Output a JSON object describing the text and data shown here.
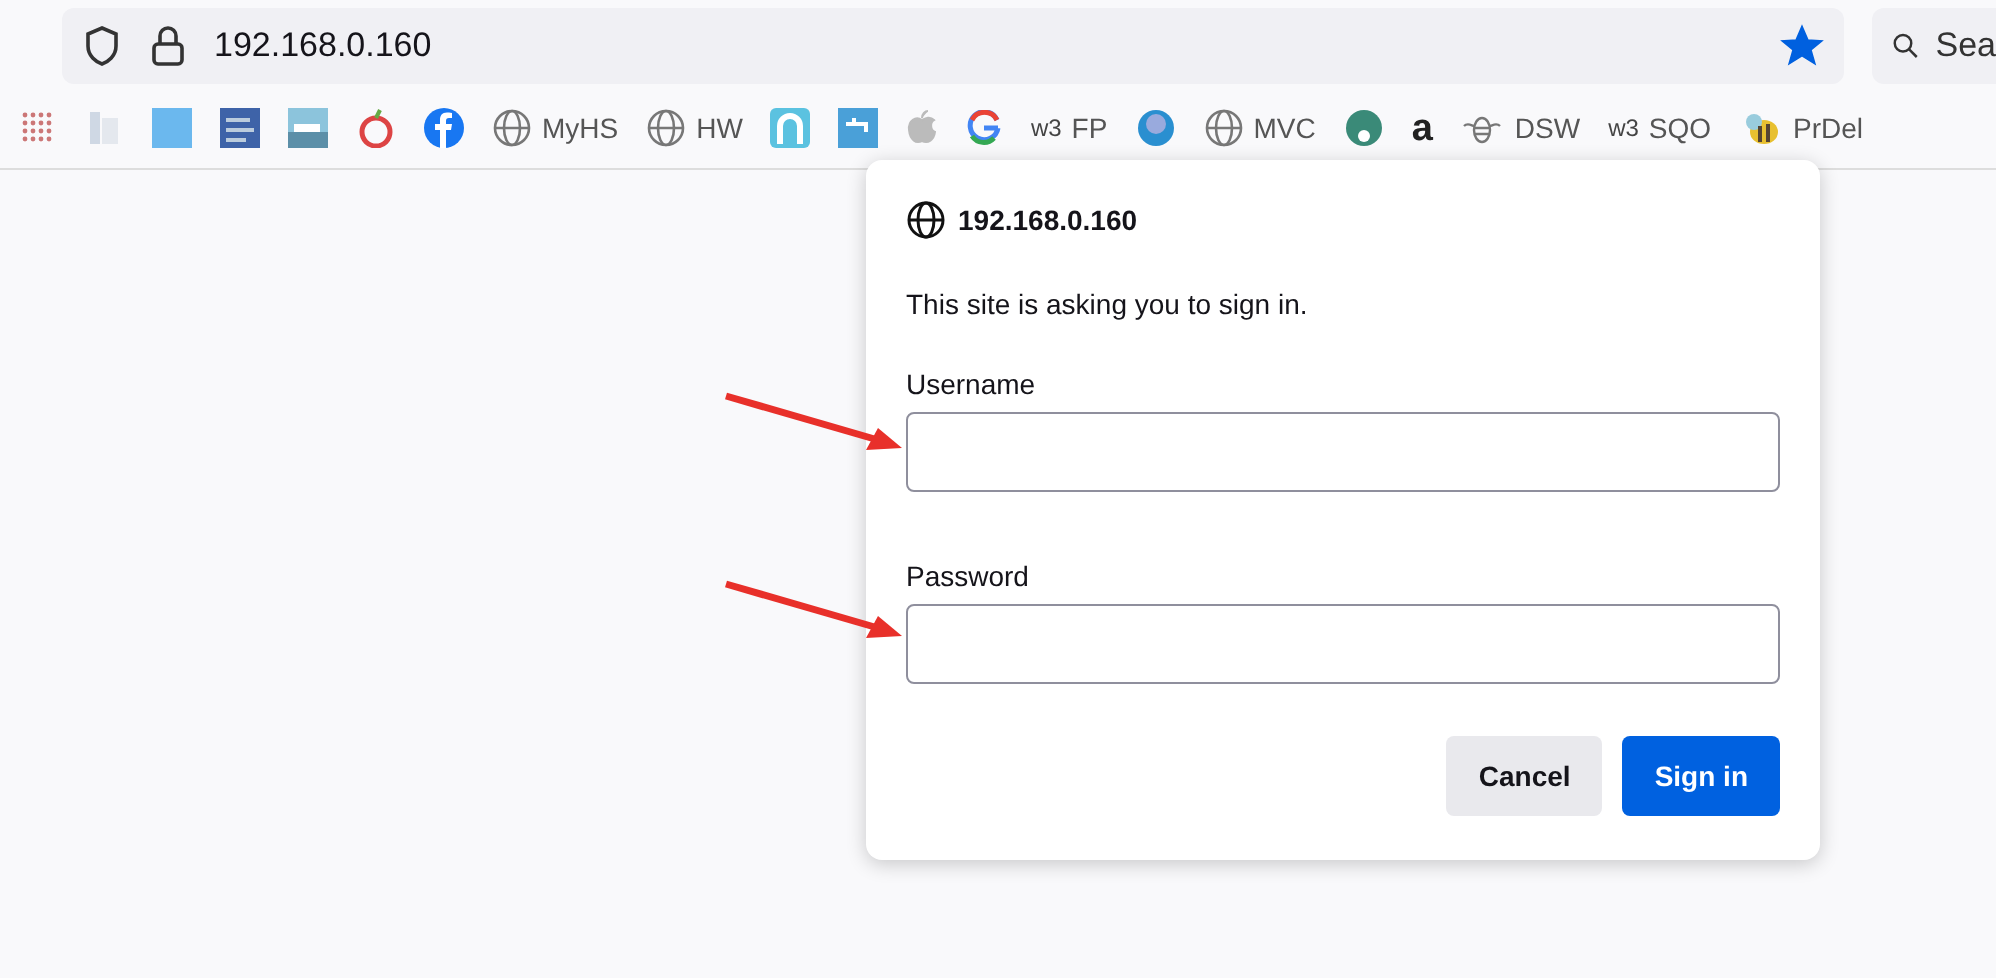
{
  "address_bar": {
    "url": "192.168.0.160",
    "bookmarked": true
  },
  "search": {
    "placeholder": "Sea"
  },
  "bookmarks": [
    {
      "kind": "grid"
    },
    {
      "kind": "doc"
    },
    {
      "kind": "square"
    },
    {
      "kind": "tile"
    },
    {
      "kind": "photo"
    },
    {
      "kind": "fruit"
    },
    {
      "kind": "facebook"
    },
    {
      "kind": "globe",
      "label": "MyHS"
    },
    {
      "kind": "globe",
      "label": "HW"
    },
    {
      "kind": "arch"
    },
    {
      "kind": "tap"
    },
    {
      "kind": "apple"
    },
    {
      "kind": "g"
    },
    {
      "kind": "w3",
      "badge": "w3",
      "label": "FP"
    },
    {
      "kind": "shield"
    },
    {
      "kind": "globe",
      "label": "MVC"
    },
    {
      "kind": "fan"
    },
    {
      "kind": "amazon",
      "badge": "a"
    },
    {
      "kind": "bug",
      "label": "DSW"
    },
    {
      "kind": "w3",
      "badge": "w3",
      "label": "SQO"
    },
    {
      "kind": "bee",
      "label": "PrDel"
    }
  ],
  "dialog": {
    "host": "192.168.0.160",
    "message": "This site is asking you to sign in.",
    "fields": [
      {
        "label": "Username",
        "annotated": true
      },
      {
        "label": "Password",
        "annotated": true
      }
    ],
    "buttons": [
      {
        "label": "Cancel",
        "kind": "secondary"
      },
      {
        "label": "Sign in",
        "kind": "primary"
      }
    ]
  }
}
